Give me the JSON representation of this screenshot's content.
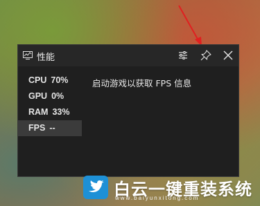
{
  "widget": {
    "title": "性能",
    "metrics": [
      {
        "name": "CPU",
        "value": "70%"
      },
      {
        "name": "GPU",
        "value": "0%"
      },
      {
        "name": "RAM",
        "value": "33%"
      },
      {
        "name": "FPS",
        "value": "--"
      }
    ],
    "message": "启动游戏以获取 FPS 信息",
    "icons": {
      "title": "performance-monitor-icon",
      "settings": "sliders-icon",
      "pin": "pin-icon",
      "close": "close-icon"
    }
  },
  "watermark": {
    "name": "白云一键重装系统",
    "url": "www.baiyunxitong.com",
    "logo": "twitter-bird-icon"
  },
  "colors": {
    "panel": "#1f1f1f",
    "titlebar": "#272727",
    "active_row": "#3b3b3b",
    "brand_blue": "#1e90d6",
    "annotation_arrow": "#e02020"
  }
}
